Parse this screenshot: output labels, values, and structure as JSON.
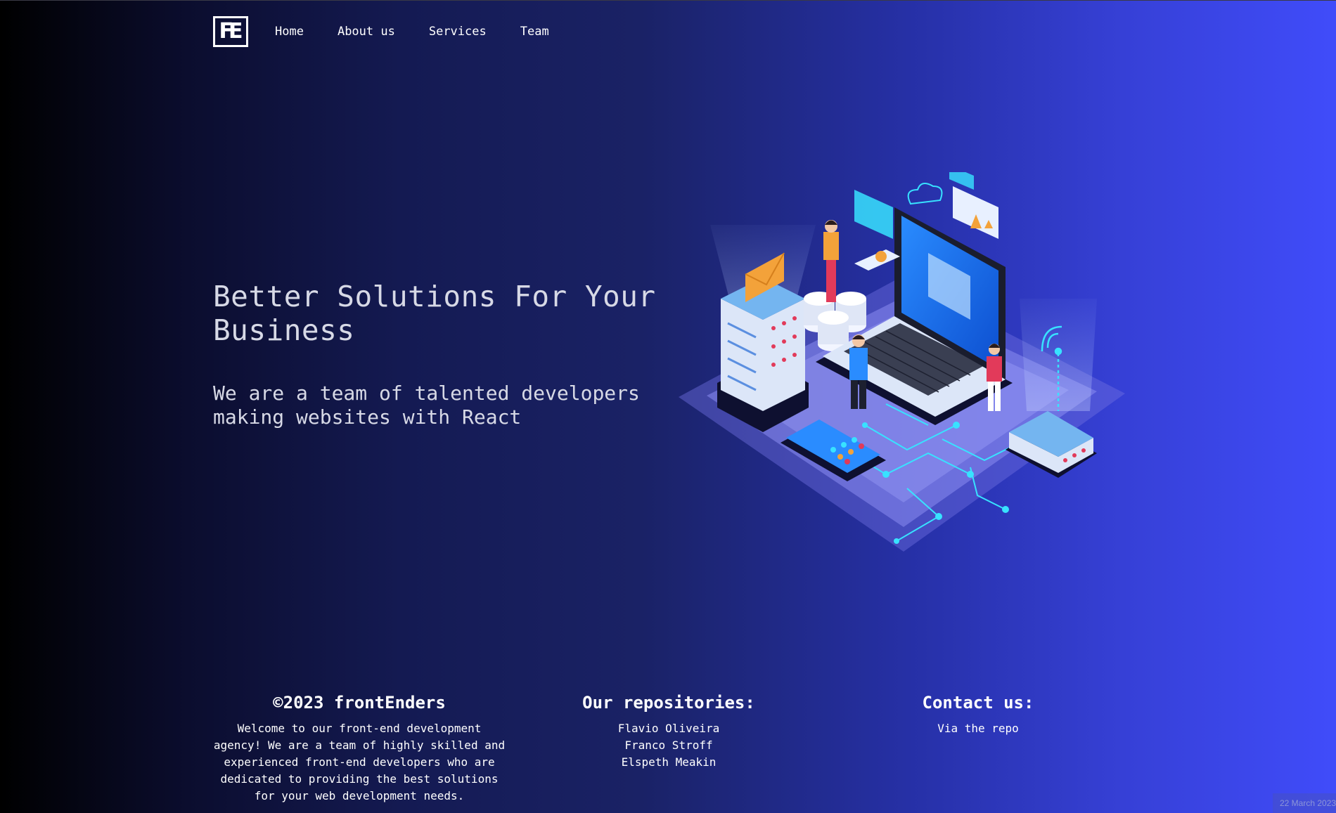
{
  "nav": {
    "logo_text": "FE",
    "links": [
      "Home",
      "About us",
      "Services",
      "Team"
    ]
  },
  "hero": {
    "title": "Better Solutions For Your Business",
    "subtitle": "We are a team of talented developers making websites with React"
  },
  "footer": {
    "about": {
      "title": "©2023 frontEnders",
      "text": "Welcome to our front-end development agency! We are a team of highly skilled and experienced front-end developers who are dedicated to providing the best solutions for your web development needs."
    },
    "repositories": {
      "title": "Our repositories:",
      "links": [
        "Flavio Oliveira",
        "Franco Stroff",
        "Elspeth Meakin"
      ]
    },
    "contact": {
      "title": "Contact us:",
      "link": "Via the repo"
    }
  },
  "datestamp": "22 March 2023",
  "colors": {
    "background_start": "#000000",
    "background_end": "#404cfa",
    "text": "#ffffff",
    "hero_text": "#d7d9e6",
    "accent_cyan": "#38e2ff",
    "accent_orange": "#f3a23a"
  }
}
